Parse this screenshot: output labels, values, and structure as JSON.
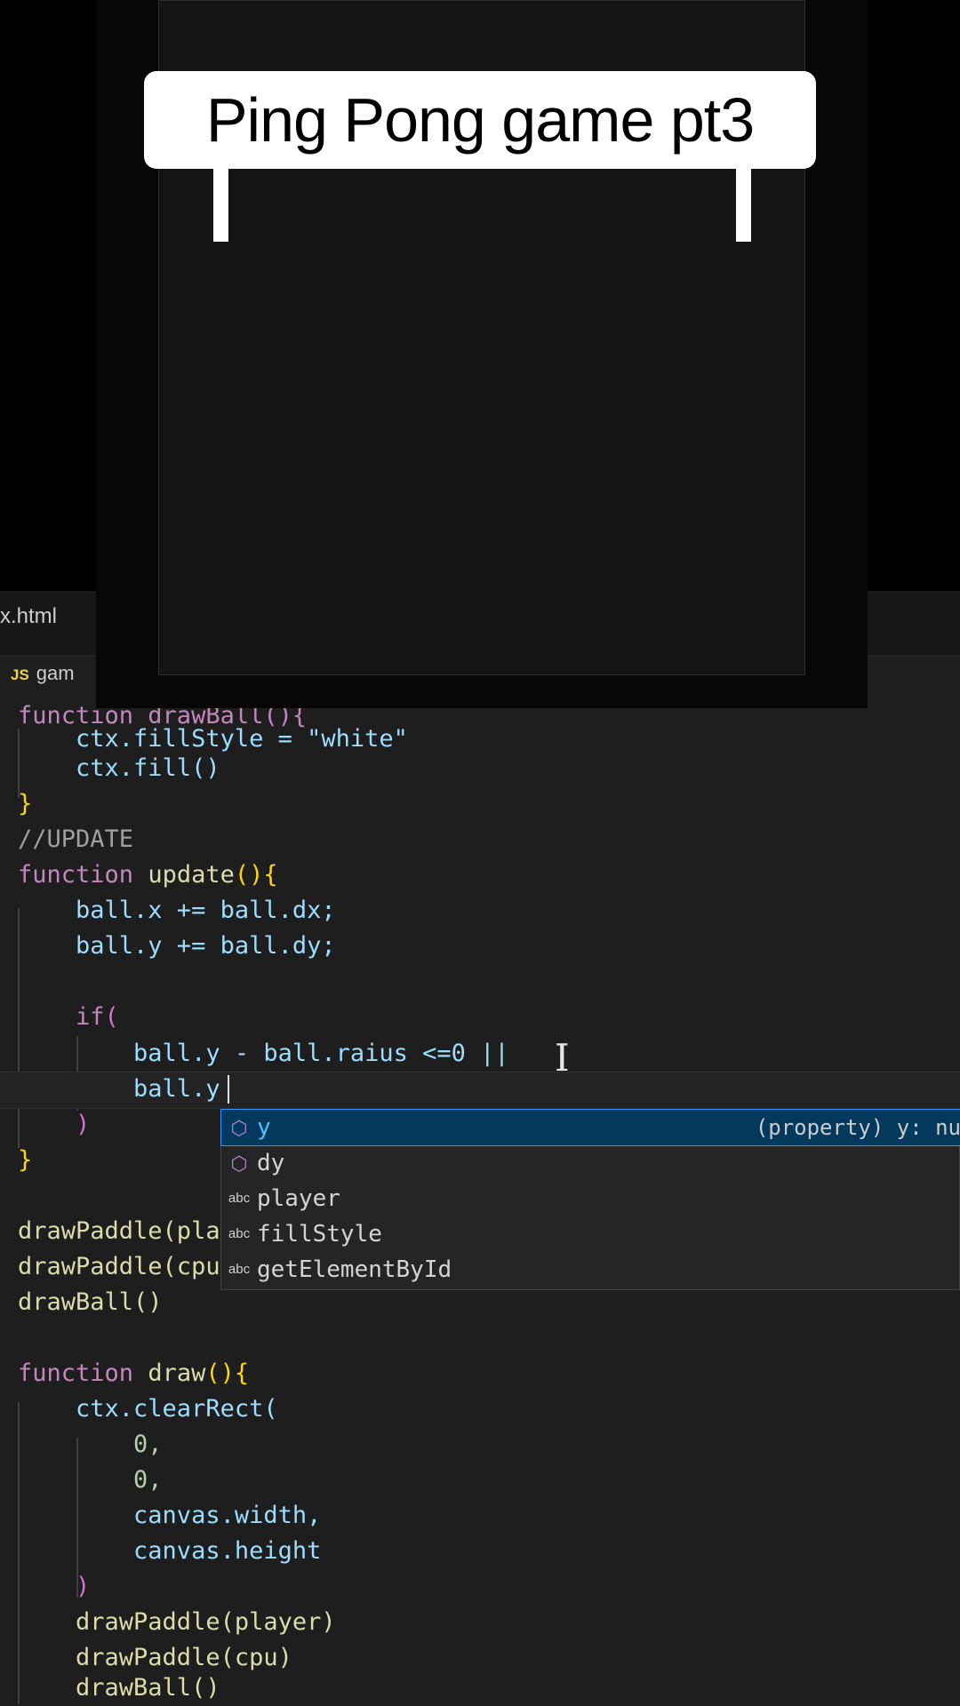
{
  "title_banner": "Ping Pong game pt3",
  "tabs": {
    "html_tab": "x.html",
    "js_tab": "gam",
    "js_badge": "JS"
  },
  "code": {
    "l0": "function drawBall(){",
    "l1": "    ctx.fillStyle = \"white\"",
    "l2": "    ctx.fill()",
    "l3": "}",
    "l4": "//UPDATE",
    "l5_kw": "function ",
    "l5_fn": "update",
    "l5_br": "(){",
    "l6": "    ball.x += ball.dx;",
    "l7": "    ball.y += ball.dy;",
    "l8_kw": "    if",
    "l8_br": "(",
    "l9": "        ball.y - ball.raius <=0 ||",
    "l10": "        ball.y",
    "l11": "    )",
    "l12": "}",
    "l13": "drawPaddle(pla",
    "l14": "drawPaddle(cpu",
    "l15": "drawBall()",
    "l16_kw": "function ",
    "l16_fn": "draw",
    "l16_br": "(){",
    "l17": "    ctx.clearRect(",
    "l18": "        0,",
    "l19": "        0,",
    "l20": "        canvas.width,",
    "l21": "        canvas.height",
    "l22": "    )",
    "l23": "    drawPaddle(player)",
    "l24": "    drawPaddle(cpu)",
    "l25": "    drawBall()"
  },
  "suggestions": [
    {
      "icon": "cube-icon",
      "label": "y",
      "detail": "(property) y: nu"
    },
    {
      "icon": "cube-icon",
      "label": "dy",
      "detail": ""
    },
    {
      "icon": "abc-icon",
      "label": "player",
      "detail": ""
    },
    {
      "icon": "abc-icon",
      "label": "fillStyle",
      "detail": ""
    },
    {
      "icon": "abc-icon",
      "label": "getElementById",
      "detail": ""
    }
  ],
  "icon_glyphs": {
    "cube": "⬡",
    "abc": "abc"
  },
  "colors": {
    "keyword": "#c586c0",
    "function": "#dcdcaa",
    "variable": "#9cdcfe",
    "selection": "#04395e"
  }
}
